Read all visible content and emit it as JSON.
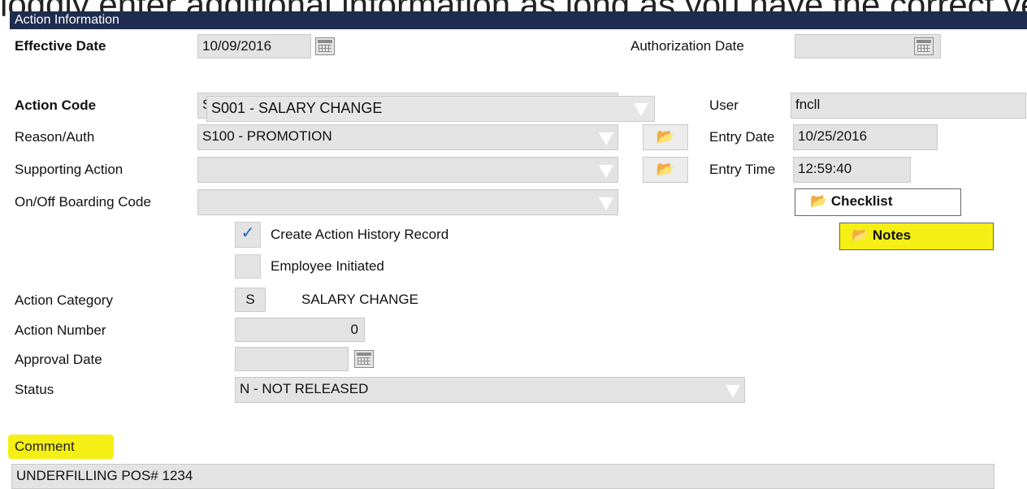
{
  "top_strip": {
    "text": "loddly enter additional information as long as you have the correct vector as the notes section"
  },
  "section": {
    "title": "Action Information"
  },
  "form": {
    "effective_date": {
      "label": "Effective Date",
      "value": "10/09/2016"
    },
    "authorization_date": {
      "label": "Authorization Date",
      "value": ""
    },
    "action_code": {
      "label": "Action Code",
      "value": "S001 - SALARY CHANGE",
      "underlying_char": "S"
    },
    "reason_auth": {
      "label": "Reason/Auth",
      "value": "S100 - PROMOTION"
    },
    "supporting_action": {
      "label": "Supporting Action",
      "value": ""
    },
    "onoff_boarding_code": {
      "label": "On/Off Boarding Code",
      "value": ""
    },
    "user": {
      "label": "User",
      "value": "fncll"
    },
    "entry_date": {
      "label": "Entry Date",
      "value": "10/25/2016"
    },
    "entry_time": {
      "label": "Entry Time",
      "value": "12:59:40"
    },
    "create_history": {
      "label": "Create Action History Record",
      "checked": true,
      "mark": "✓"
    },
    "employee_initiated": {
      "label": "Employee Initiated",
      "checked": false
    },
    "action_category": {
      "label": "Action Category",
      "code": "S",
      "description": "SALARY CHANGE"
    },
    "action_number": {
      "label": "Action Number",
      "value": "0"
    },
    "approval_date": {
      "label": "Approval Date",
      "value": ""
    },
    "status": {
      "label": "Status",
      "value": "N - NOT RELEASED"
    },
    "comment": {
      "label": "Comment",
      "value": "UNDERFILLING POS# 1234"
    }
  },
  "buttons": {
    "checklist": "Checklist",
    "notes": "Notes",
    "folder_icon": "open-folder-icon",
    "folder_glyph": "📂"
  },
  "colors": {
    "titlebar": "#1e2c4f",
    "highlight": "#f5ef15",
    "field_bg": "#e3e3e3",
    "check": "#1d5fbf"
  }
}
